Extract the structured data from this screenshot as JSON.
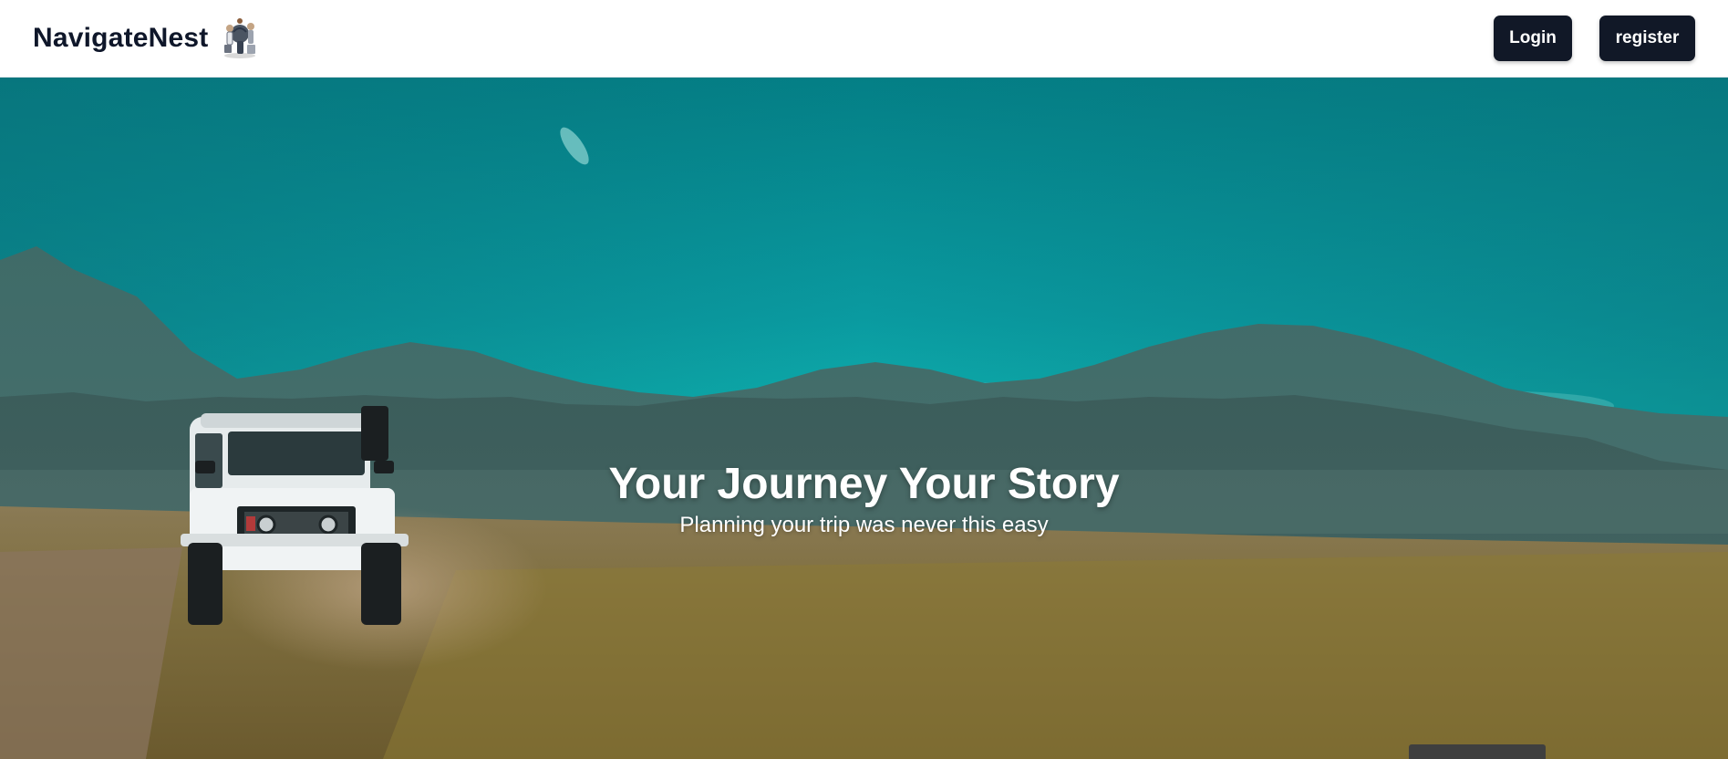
{
  "header": {
    "brand_name": "NavigateNest",
    "logo_icon": "travelers-illustration-icon",
    "login_label": "Login",
    "register_label": "register"
  },
  "hero": {
    "title": "Your Journey Your Story",
    "subtitle": "Planning your trip was never this easy",
    "background": "mountain-landscape-with-jeep"
  },
  "colors": {
    "button_bg": "#111827",
    "button_text": "#ffffff",
    "brand_text": "#0f172a",
    "sky": "#05a9a8"
  }
}
